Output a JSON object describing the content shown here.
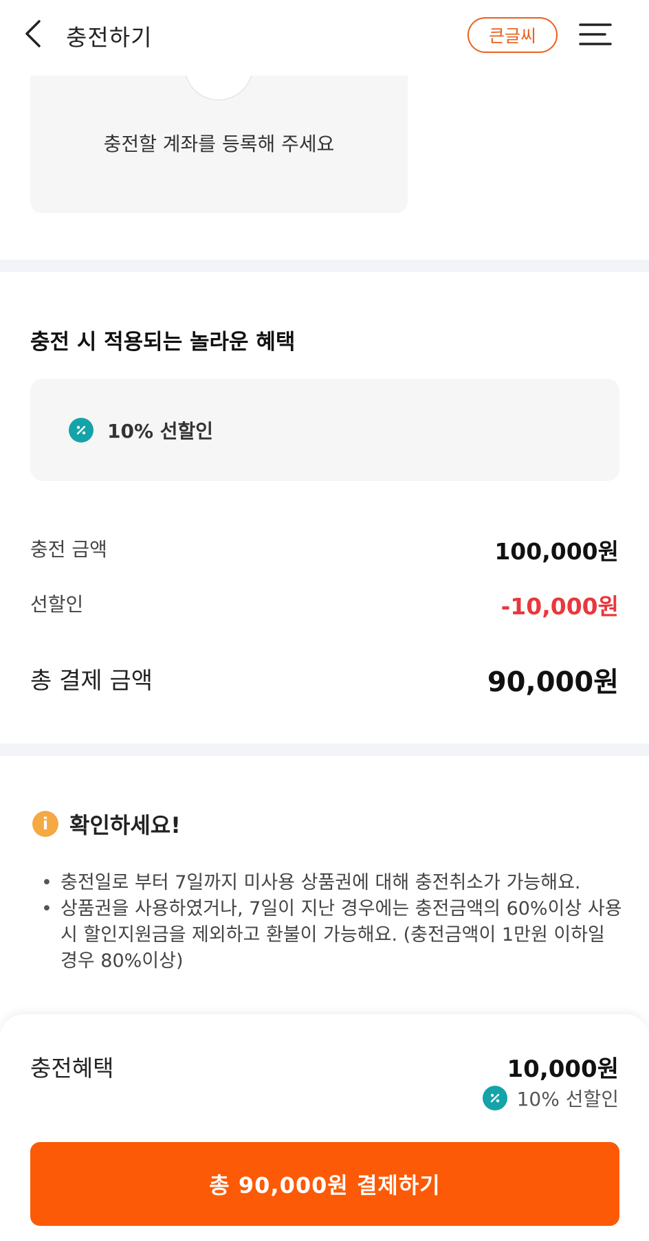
{
  "header": {
    "title": "충전하기",
    "big_font_label": "큰글씨"
  },
  "account": {
    "prompt": "충전할 계좌를 등록해 주세요"
  },
  "benefits": {
    "heading": "충전 시 적용되는 놀라운 혜택",
    "items": [
      {
        "icon": "percent-icon",
        "label": "10% 선할인"
      }
    ]
  },
  "summary": {
    "charge_amount_label": "충전 금액",
    "charge_amount_value": "100,000원",
    "discount_label": "선할인",
    "discount_value": "-10,000원",
    "total_label": "총 결제 금액",
    "total_value": "90,000원"
  },
  "notice": {
    "icon": "info-icon",
    "title": "확인하세요!",
    "items": [
      "충전일로 부터 7일까지 미사용 상품권에 대해 충전취소가 가능해요.",
      "상품권을 사용하였거나, 7일이 지난 경우에는 충전금액의 60%이상 사용 시 할인지원금을 제외하고 환불이 가능해요. (충전금액이 1만원 이하일 경우 80%이상)"
    ]
  },
  "bottom_sheet": {
    "benefit_label": "충전혜택",
    "benefit_value": "10,000원",
    "benefit_sub": "10% 선할인",
    "pay_button_label": "총 90,000원 결제하기"
  },
  "colors": {
    "accent": "#fc5a06",
    "outline_accent": "#e8601b",
    "discount": "#e8383d",
    "teal": "#14a3a8",
    "notice": "#f5a943"
  }
}
